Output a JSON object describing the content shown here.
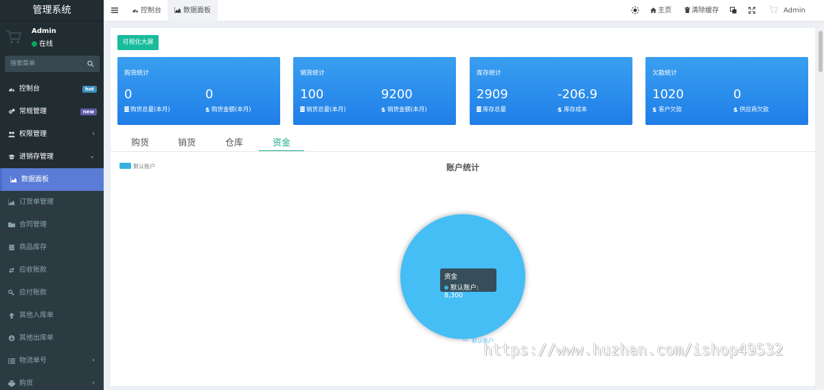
{
  "app_title": "管理系统",
  "user": {
    "name": "Admin",
    "status": "在线"
  },
  "search": {
    "placeholder": "搜索菜单"
  },
  "sidebar": {
    "items": [
      {
        "label": "控制台",
        "icon": "dashboard-icon",
        "badge": "hot",
        "type": "main"
      },
      {
        "label": "常规管理",
        "icon": "cogs-icon",
        "badge": "new",
        "type": "main"
      },
      {
        "label": "权限管理",
        "icon": "users-icon",
        "chevron": "‹",
        "type": "main"
      },
      {
        "label": "进销存管理",
        "icon": "graduation-cap-icon",
        "chevron": "⌄",
        "type": "main"
      },
      {
        "label": "数据面板",
        "icon": "area-chart-icon",
        "type": "active"
      },
      {
        "label": "订货单管理",
        "icon": "area-chart-icon",
        "type": "sub"
      },
      {
        "label": "合同管理",
        "icon": "folder-icon",
        "type": "sub"
      },
      {
        "label": "商品库存",
        "icon": "database-icon",
        "type": "sub"
      },
      {
        "label": "应收账款",
        "icon": "exchange-icon",
        "type": "sub"
      },
      {
        "label": "应付账款",
        "icon": "key-icon",
        "type": "sub"
      },
      {
        "label": "其他入库单",
        "icon": "arrow-up-icon",
        "type": "sub"
      },
      {
        "label": "其他出库单",
        "icon": "arrow-circle-down-icon",
        "type": "sub"
      },
      {
        "label": "物流单号",
        "icon": "list-icon",
        "chevron": "‹",
        "type": "sub"
      },
      {
        "label": "购货",
        "icon": "print-icon",
        "chevron": "‹",
        "type": "sub"
      }
    ]
  },
  "topbar": {
    "tabs": [
      {
        "label": "控制台",
        "icon": "dashboard-icon"
      },
      {
        "label": "数据面板",
        "icon": "area-chart-icon"
      }
    ],
    "right": {
      "home": "主页",
      "clear_cache": "清除缓存",
      "user": "Admin"
    }
  },
  "main": {
    "screen_button": "可视化大屏",
    "cards": [
      {
        "title": "购货统计",
        "left_value": "0",
        "left_label": "购货总量(本月)",
        "left_icon": "database-icon",
        "right_value": "0",
        "right_label": "购货金额(本月)",
        "right_icon": "dollar-icon"
      },
      {
        "title": "销货统计",
        "left_value": "100",
        "left_label": "销货总量(本月)",
        "left_icon": "database-icon",
        "right_value": "9200",
        "right_label": "销货金额(本月)",
        "right_icon": "dollar-icon"
      },
      {
        "title": "库存统计",
        "left_value": "2909",
        "left_label": "库存总量",
        "left_icon": "database-icon",
        "right_value": "-206.9",
        "right_label": "库存成本",
        "right_icon": "dollar-icon"
      },
      {
        "title": "欠款统计",
        "left_value": "1020",
        "left_label": "客户欠款",
        "left_icon": "dollar-icon",
        "right_value": "0",
        "right_label": "供应商欠款",
        "right_icon": "dollar-icon"
      }
    ],
    "tabs": [
      "购货",
      "销货",
      "仓库",
      "资金"
    ],
    "active_tab": "资金"
  },
  "chart_data": {
    "type": "pie",
    "title": "账户统计",
    "legend": [
      "默认账户"
    ],
    "legend_placement": "top-left",
    "series_name": "资金",
    "slices": [
      {
        "name": "默认账户",
        "value": 8300
      }
    ],
    "tooltip": {
      "title": "资金",
      "text": "默认账户: 8,300"
    },
    "colors": {
      "slice": "#44bdf5"
    }
  },
  "watermark": "https://www.huzhan.com/ishop49532",
  "colors": {
    "sidebar": "#222d32",
    "active_menu": "#5a7cd6",
    "card": "#2b8cee",
    "accent": "#18bc9c"
  }
}
